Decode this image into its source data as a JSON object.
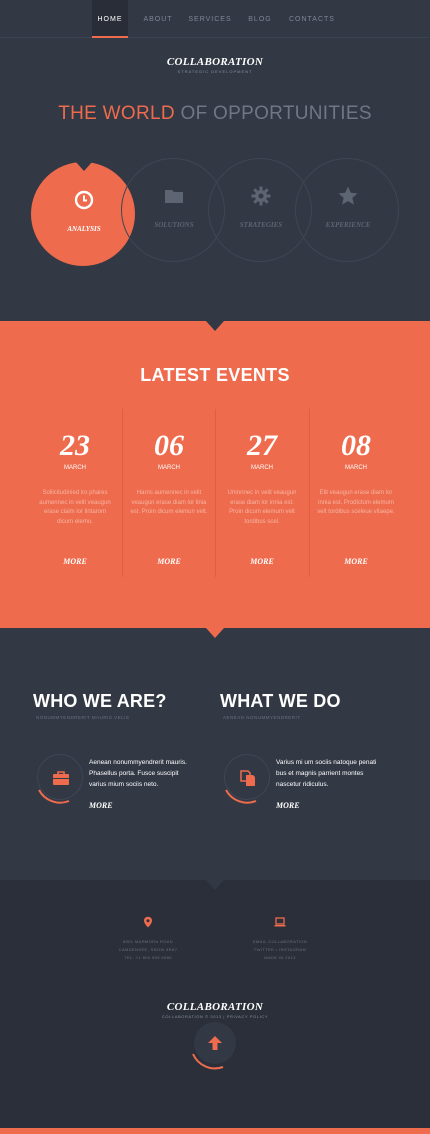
{
  "nav": {
    "items": [
      {
        "label": "HOME",
        "active": true
      },
      {
        "label": "ABOUT",
        "active": false
      },
      {
        "label": "SERVICES",
        "active": false
      },
      {
        "label": "BLOG",
        "active": false
      },
      {
        "label": "CONTACTS",
        "active": false
      }
    ]
  },
  "brand": {
    "logo": "COLLABORATION",
    "tagline": "STRATEGIC DEVELOPMENT"
  },
  "hero": {
    "headline_accent": "THE WORLD",
    "headline_rest": "OF OPPORTUNITIES",
    "circles": [
      {
        "label": "ANALYSIS",
        "icon": "clock-icon",
        "active": true
      },
      {
        "label": "SOLUTIONS",
        "icon": "folder-icon",
        "active": false
      },
      {
        "label": "STRATEGIES",
        "icon": "gear-icon",
        "active": false
      },
      {
        "label": "EXPERIENCE",
        "icon": "star-icon",
        "active": false
      }
    ]
  },
  "events": {
    "title": "LATEST EVENTS",
    "items": [
      {
        "day": "23",
        "month": "MARCH",
        "text": "Sollicitudinied iro phares aumennec in velit veaugun erase claim lor lintarom dicum elemu.",
        "more": "MORE"
      },
      {
        "day": "06",
        "month": "MARCH",
        "text": "Harns aumennec in velit veaugun erase diam lor linia est. Proin dicum elemun velt.",
        "more": "MORE"
      },
      {
        "day": "27",
        "month": "MARCH",
        "text": "Umnnnec in velit veaugun erase diam lor innia est. Proin dicum elemum velt tordibus scel.",
        "more": "MORE"
      },
      {
        "day": "08",
        "month": "MARCH",
        "text": "Elit veaugun erase diam lor innia est. Prodictum elemum velt tordibus sceleue vitaepe.",
        "more": "MORE"
      }
    ]
  },
  "who": {
    "title": "WHO WE ARE?",
    "subtitle": "NONUMMYENDRERIT MAURIS VELIS",
    "icon": "briefcase-icon",
    "text": [
      "Aenean nonummyendrerit mauris.",
      "Phasellus porta. Fusce suscipit",
      "varius mium sociis neto."
    ],
    "more": "MORE"
  },
  "what": {
    "title": "WHAT WE DO",
    "subtitle": "AENEAN NONUMMYENDRERIT",
    "icon": "documents-icon",
    "text": [
      "Varius mi um sociis natoque penati",
      "bus et magnis parrient montes",
      "nascetur ridiculus."
    ],
    "more": "MORE"
  },
  "footer": {
    "address": [
      "8901 MARMORA ROAD",
      "CAMDENSEE, SNOW 8R87",
      "TEL: +1 800 559 6580"
    ],
    "contact": [
      "EMAIL COLLABORATION",
      "TWITTER • INSTAGRAM",
      "MADE IN 2013"
    ],
    "logo": "COLLABORATION",
    "copyright": "COLLABORATION © 2013 | PRIVACY POLICY"
  },
  "colors": {
    "accent": "#ee6b4d",
    "dark": "#323844",
    "darker": "#2a2f39"
  }
}
